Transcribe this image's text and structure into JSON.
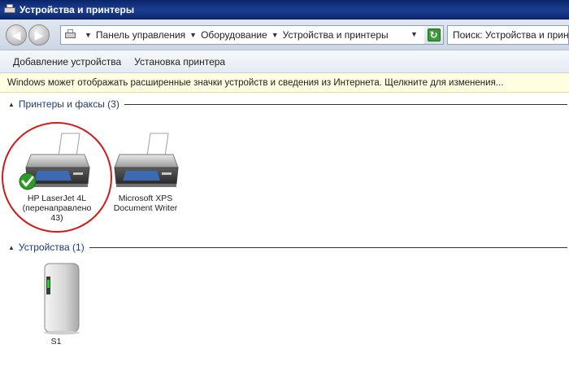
{
  "window": {
    "title": "Устройства и принтеры"
  },
  "address_bar": {
    "breadcrumbs": [
      "Панель управления",
      "Оборудование",
      "Устройства и принтеры"
    ]
  },
  "search": {
    "placeholder": "Поиск: Устройства и принтеры"
  },
  "command_bar": {
    "add_device_label": "Добавление устройства",
    "add_printer_label": "Установка принтера"
  },
  "info_bar": {
    "text": "Windows может отображать расширенные значки устройств и сведения из Интернета.  Щелкните для изменения..."
  },
  "groups": {
    "printers": {
      "label": "Принтеры и факсы",
      "count": "(3)",
      "items": [
        {
          "caption_lines": [
            "HP LaserJet 4L",
            "(перенаправлено",
            "43)"
          ],
          "is_default": true
        },
        {
          "caption_lines": [
            "Microsoft XPS",
            "Document Writer"
          ],
          "is_default": false
        }
      ]
    },
    "devices": {
      "label": "Устройства",
      "count": "(1)",
      "items": [
        {
          "caption_lines": [
            "S1"
          ]
        }
      ]
    }
  },
  "colors": {
    "highlight_ring": "#d11a1a",
    "default_check": "#2f9a2a"
  }
}
